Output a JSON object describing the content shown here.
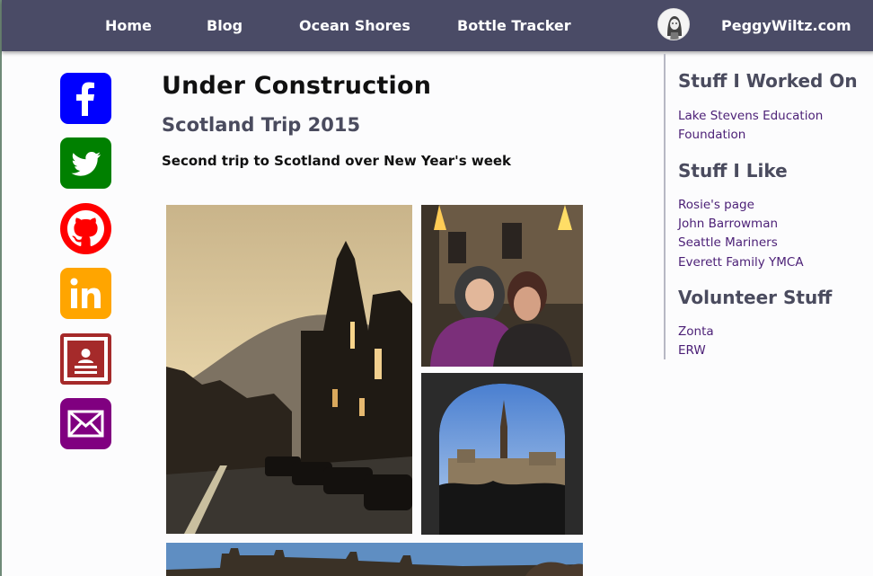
{
  "nav": {
    "links": [
      "Home",
      "Blog",
      "Ocean Shores",
      "Bottle Tracker"
    ],
    "site_name": "PeggyWiltz.com"
  },
  "social": {
    "items": [
      {
        "name": "facebook",
        "color": "#0000ff"
      },
      {
        "name": "twitter",
        "color": "#008000"
      },
      {
        "name": "github",
        "color": "#ff0000"
      },
      {
        "name": "linkedin",
        "color": "#ffa500"
      },
      {
        "name": "resume",
        "color": "#a52a2a"
      },
      {
        "name": "email",
        "color": "#800080"
      }
    ]
  },
  "main": {
    "title": "Under Construction",
    "subtitle": "Scotland Trip 2015",
    "description": "Second trip to Scotland over New Year's week"
  },
  "sidebar": {
    "sections": [
      {
        "heading": "Stuff I Worked On",
        "links": [
          "Lake Stevens Education",
          "Foundation"
        ]
      },
      {
        "heading": "Stuff I Like",
        "links": [
          "Rosie's page",
          "John Barrowman",
          "Seattle Mariners",
          "Everett Family YMCA"
        ]
      },
      {
        "heading": "Volunteer Stuff",
        "links": [
          "Zonta",
          "ERW"
        ]
      }
    ]
  }
}
